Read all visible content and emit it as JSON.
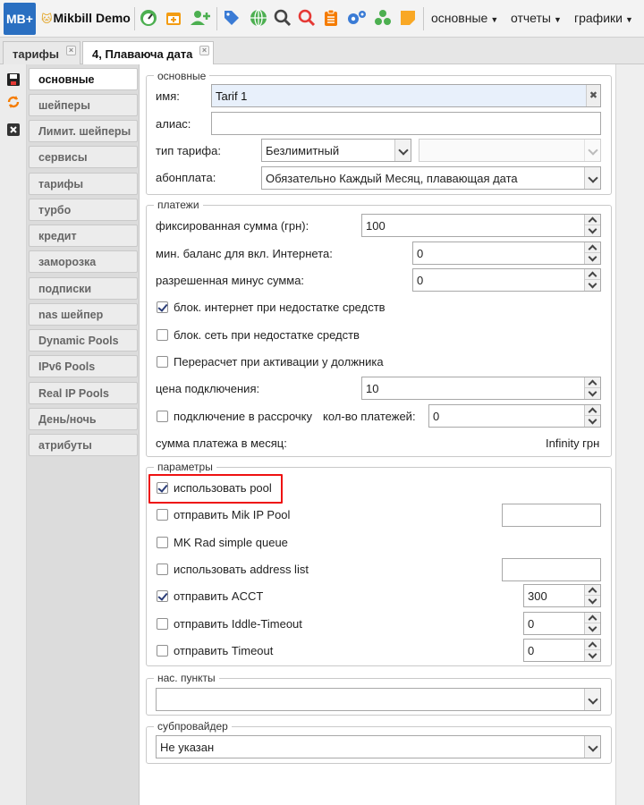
{
  "app": {
    "logo": "MB+",
    "name": "Mikbill Demo"
  },
  "toolbar": {
    "icons": [
      "dashboard-icon",
      "calendar-add-icon",
      "add-user-icon",
      "tag-icon",
      "globe-icon",
      "search-icon",
      "search-red-icon",
      "clipboard-icon",
      "gears-icon",
      "modules-icon",
      "note-icon"
    ],
    "menus": [
      {
        "label": "основные"
      },
      {
        "label": "отчеты"
      },
      {
        "label": "графики"
      }
    ]
  },
  "tabs": [
    {
      "label": "тарифы"
    },
    {
      "label": "4, Плаваюча дата"
    }
  ],
  "sidebar": {
    "items": [
      {
        "label": "основные"
      },
      {
        "label": "шейперы"
      },
      {
        "label": "Лимит. шейперы"
      },
      {
        "label": "сервисы"
      },
      {
        "label": "тарифы"
      },
      {
        "label": "турбо"
      },
      {
        "label": "кредит"
      },
      {
        "label": "заморозка"
      },
      {
        "label": "подписки"
      },
      {
        "label": "nas шейпер"
      },
      {
        "label": "Dynamic Pools"
      },
      {
        "label": "IPv6 Pools"
      },
      {
        "label": "Real IP Pools"
      },
      {
        "label": "День/ночь"
      },
      {
        "label": "атрибуты"
      }
    ]
  },
  "basic": {
    "legend": "основные",
    "name_label": "имя:",
    "name_value": "Tarif 1",
    "alias_label": "алиас:",
    "alias_value": "",
    "tariff_type_label": "тип тарифа:",
    "tariff_type_value": "Безлимитный",
    "fee_label": "абонплата:",
    "fee_value": "Обязательно Каждый Месяц, плавающая дата"
  },
  "payments": {
    "legend": "платежи",
    "fixed_label": "фиксированная сумма (грн):",
    "fixed_value": "100",
    "minbal_label": "мин. баланс для вкл. Интернета:",
    "minbal_value": "0",
    "minus_label": "разрешенная минус сумма:",
    "minus_value": "0",
    "block_inet_label": "блок. интернет при недостатке средств",
    "block_inet_checked": true,
    "block_net_label": "блок. сеть при недостатке средств",
    "block_net_checked": false,
    "recalc_label": "Перерасчет при активации у должника",
    "recalc_checked": false,
    "connect_price_label": "цена подключения:",
    "connect_price_value": "10",
    "installment_label": "подключение в рассрочку",
    "installment_checked": false,
    "installment_count_label": "кол-во платежей:",
    "installment_count_value": "0",
    "monthly_label": "сумма платежа в месяц:",
    "monthly_value": "Infinity грн"
  },
  "params": {
    "legend": "параметры",
    "use_pool_label": "использовать pool",
    "use_pool_checked": true,
    "mik_pool_label": "отправить Mik IP Pool",
    "mik_pool_checked": false,
    "mik_pool_value": "",
    "mk_queue_label": "MK Rad simple queue",
    "mk_queue_checked": false,
    "address_list_label": "использовать address list",
    "address_list_checked": false,
    "address_list_value": "",
    "acct_label": "отправить ACCT",
    "acct_checked": true,
    "acct_value": "300",
    "idle_label": "отправить Iddle-Timeout",
    "idle_checked": false,
    "idle_value": "0",
    "timeout_label": "отправить Timeout",
    "timeout_checked": false,
    "timeout_value": "0"
  },
  "locations": {
    "legend": "нас. пункты",
    "value": ""
  },
  "subprovider": {
    "legend": "субпровайдер",
    "value": "Не указан"
  }
}
